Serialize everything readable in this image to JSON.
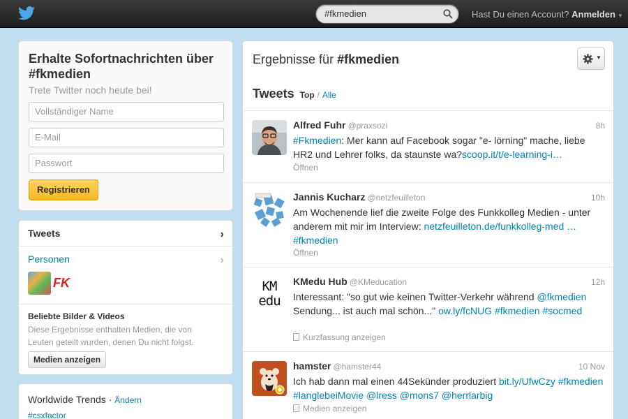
{
  "header": {
    "search_value": "#fkmedien",
    "account_prompt": "Hast Du einen Account?",
    "login_label": "Anmelden",
    "logo_icon": "twitter-bird-icon",
    "brand_color": "#1da1f2"
  },
  "signup": {
    "title": "Erhalte Sofortnachrichten über #fkmedien",
    "subtitle": "Trete Twitter noch heute bei!",
    "name_placeholder": "Vollständiger Name",
    "email_placeholder": "E-Mail",
    "password_placeholder": "Passwort",
    "register_label": "Registrieren"
  },
  "nav": {
    "tweets_label": "Tweets",
    "people_label": "Personen",
    "media_title": "Beliebte Bilder & Videos",
    "media_desc": "Diese Ergebnisse enthalten Medien, die von Leuten geteilt wurden, denen Du nicht folgst.",
    "media_button": "Medien anzeigen",
    "people_thumb_b": "FK"
  },
  "trends": {
    "title": "Worldwide Trends",
    "separator": "·",
    "change_label": "Ändern",
    "first_tag": "#csxfactor"
  },
  "results": {
    "prefix": "Ergebnisse für",
    "query": "#fkmedien",
    "tweets_heading": "Tweets",
    "tab_top": "Top",
    "tab_sep": "/",
    "tab_all": "Alle",
    "gear_icon": "gear-icon"
  },
  "tweets": [
    {
      "name": "Alfred Fuhr",
      "handle": "@praxsozi",
      "time": "8h",
      "text_parts": [
        {
          "t": "#Fkmedien",
          "link": true
        },
        {
          "t": ": Mer kann auf Facebook sogar \"e- lörning\" mache, liebe HR2 und Lehrer folks, da staunste wa?",
          "link": false
        },
        {
          "t": "scoop.it/t/e-learning-i…",
          "link": true
        }
      ],
      "action": "Öffnen"
    },
    {
      "name": "Jannis Kucharz",
      "handle": "@netzfeuilleton",
      "time": "10h",
      "text_parts": [
        {
          "t": "Am Wochenende lief die zweite Folge des Funkkolleg Medien - unter anderem mit mir im Interview: ",
          "link": false
        },
        {
          "t": "netzfeuilleton.de/funkkolleg-med …",
          "link": true
        },
        {
          "t": " ",
          "link": false
        },
        {
          "t": "#fkmedien",
          "link": true
        }
      ],
      "action": "Öffnen"
    },
    {
      "name": "KMedu Hub",
      "handle": "@KMeducation",
      "time": "12h",
      "avatar_text": "KM edu",
      "text_parts": [
        {
          "t": "Interessant: \"so gut wie keinen Twitter-Verkehr während ",
          "link": false
        },
        {
          "t": "@fkmedien",
          "link": true
        },
        {
          "t": " Sendung... ist auch mal schön...\" ",
          "link": false
        },
        {
          "t": "ow.ly/fcNUG",
          "link": true
        },
        {
          "t": " ",
          "link": false
        },
        {
          "t": "#fkmedien",
          "link": true
        },
        {
          "t": " ",
          "link": false
        },
        {
          "t": "#socmed",
          "link": true
        }
      ],
      "action": "Kurzfassung anzeigen"
    },
    {
      "name": "hamster",
      "handle": "@hamster44",
      "time": "10 Nov",
      "text_parts": [
        {
          "t": "Ich hab dann mal einen 44Sekünder produziert ",
          "link": false
        },
        {
          "t": "bit.ly/UfwCzy",
          "link": true
        },
        {
          "t": " ",
          "link": false
        },
        {
          "t": "#fkmedien",
          "link": true
        },
        {
          "t": " ",
          "link": false
        },
        {
          "t": "#langlebeiMovie",
          "link": true
        },
        {
          "t": " ",
          "link": false
        },
        {
          "t": "@lress",
          "link": true
        },
        {
          "t": " ",
          "link": false
        },
        {
          "t": "@mons7",
          "link": true
        },
        {
          "t": " ",
          "link": false
        },
        {
          "t": "@herrlarbig",
          "link": true
        }
      ],
      "action": "Medien anzeigen"
    }
  ]
}
